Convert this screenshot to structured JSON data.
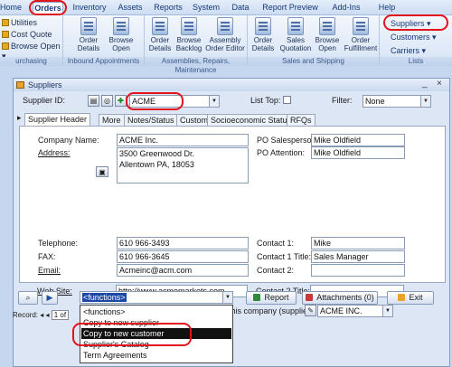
{
  "ribbon": {
    "tabs": [
      "Home",
      "Orders",
      "Inventory",
      "Assets",
      "Reports",
      "System",
      "Data",
      "Report Preview",
      "Add-Ins",
      "Help"
    ],
    "small_items": [
      "Utilities",
      "Cost Quote",
      "Browse Open"
    ],
    "groups": {
      "purchasing": {
        "label": "urchasing"
      },
      "inbound": {
        "label": "Inbound Appointments",
        "buttons": [
          "Order\nDetails",
          "Browse\nOpen"
        ]
      },
      "assemblies": {
        "label": "Assemblies, Repairs, Maintenance",
        "buttons": [
          "Order\nDetails",
          "Browse\nBacklog",
          "Assembly\nOrder Editor"
        ]
      },
      "sales": {
        "label": "Sales and Shipping",
        "buttons": [
          "Order\nDetails",
          "Sales\nQuotation",
          "Browse\nOpen",
          "Order\nFulfillment"
        ]
      },
      "lists": {
        "label": "Lists",
        "items": [
          "Suppliers",
          "Customers",
          "Carriers"
        ]
      }
    }
  },
  "window": {
    "title": "Suppliers",
    "supplier_id_label": "Supplier ID:",
    "supplier_id_value": "ACME",
    "list_top_label": "List Top:",
    "filter_label": "Filter:",
    "filter_value": "None",
    "tabs": [
      "Supplier Header",
      "More",
      "Notes/Status",
      "Custom",
      "Socioeconomic Status",
      "RFQs"
    ],
    "company_name_label": "Company Name:",
    "company_name": "ACME Inc.",
    "address_label": "Address:",
    "address_line1": "3500 Greenwood Dr.",
    "address_line2": "Allentown PA, 18053",
    "telephone_label": "Telephone:",
    "telephone": "610 966-3493",
    "fax_label": "FAX:",
    "fax": "610 966-3645",
    "email_label": "Email:",
    "email": "Acmeinc@acm.com",
    "website_label": "Web Site:",
    "website": "http://www.acmemarkets.com",
    "po_salesperson_label": "PO Salesperson:",
    "po_salesperson": "Mike Oldfield",
    "po_attention_label": "PO Attention:",
    "po_attention": "Mike Oldfield",
    "contact1_label": "Contact 1:",
    "contact1": "Mike",
    "contact1_title_label": "Contact 1 Title:",
    "contact1_title": "Sales Manager",
    "contact2_label": "Contact 2:",
    "contact2": "",
    "contact2_title_label": "Contact 2 Title:",
    "contact2_title": "",
    "pick_from_text": "This record is a \"Pick from\" location of this company (supplier):",
    "pick_from_value": "ACME INC.",
    "functions_value": "<functions>",
    "report_label": "Report",
    "attachments_label": "Attachments (0)",
    "exit_label": "Exit",
    "record_label": "Record:",
    "record_nav": "1 of"
  },
  "functions_dropdown": {
    "items": [
      "<functions>",
      "Copy to new supplier",
      "Copy to new customer",
      "Supplier's Catalog",
      "Term Agreements"
    ],
    "highlighted": "Copy to new customer"
  },
  "colors": {
    "highlight_ring": "#e0141a",
    "ribbon_text": "#15387a"
  }
}
